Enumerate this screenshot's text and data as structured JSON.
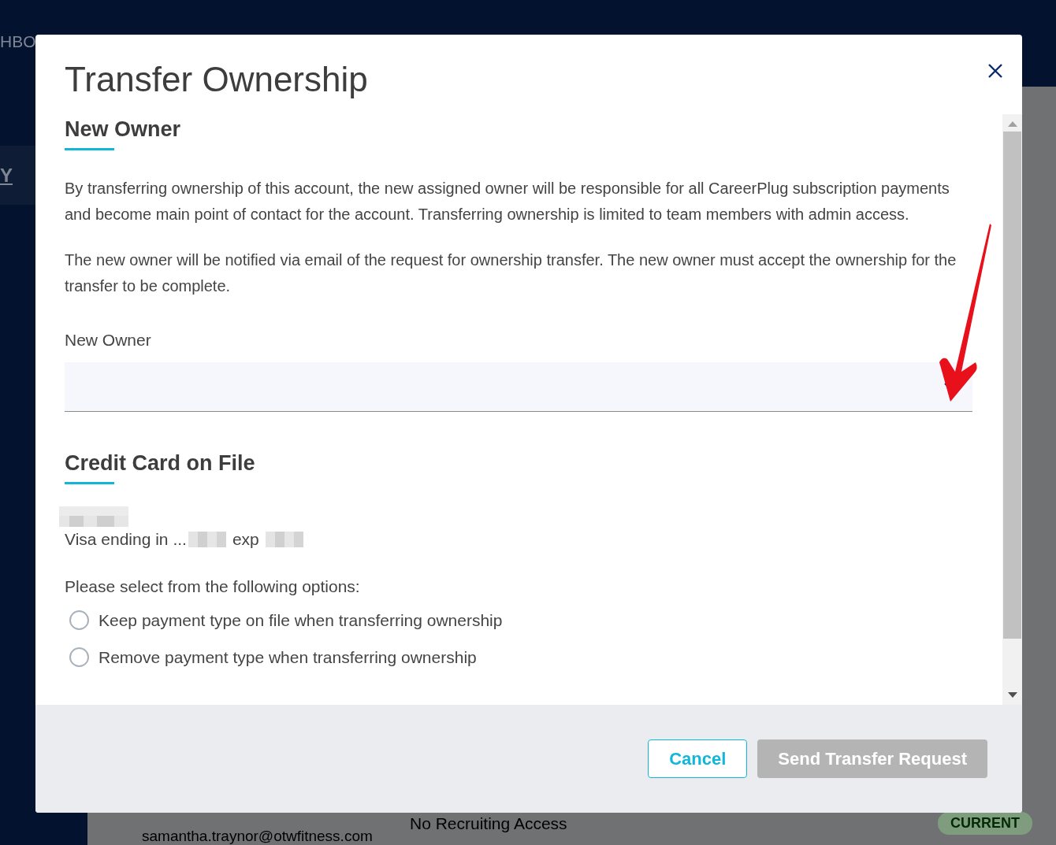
{
  "background": {
    "nav_label": "HBO",
    "side_label": "Y",
    "member_email": "samantha.traynor@otwfitness.com",
    "member_access": "No Recruiting Access",
    "member_status": "CURRENT"
  },
  "dialog": {
    "title": "Transfer Ownership",
    "new_owner": {
      "heading": "New Owner",
      "paragraphs": [
        "By transferring ownership of this account, the new assigned owner will be responsible for all CareerPlug subscription payments and become main point of contact for the account. Transferring ownership is limited to team members with admin access.",
        "The new owner will be notified via email of the request for ownership transfer. The new owner must accept the ownership for the transfer to be complete."
      ],
      "field_label": "New Owner"
    },
    "credit_card": {
      "heading": "Credit Card on File",
      "card_prefix": "Visa ending in ...",
      "exp_label": "exp",
      "prompt": "Please select from the following options:",
      "options": [
        {
          "label": "Keep payment type on file when transferring ownership",
          "selected": false
        },
        {
          "label": "Remove payment type when transferring ownership",
          "selected": false
        }
      ]
    },
    "buttons": [
      {
        "label": "Cancel",
        "kind": "secondary",
        "disabled": false
      },
      {
        "label": "Send Transfer Request",
        "kind": "primary",
        "disabled": true
      }
    ]
  }
}
